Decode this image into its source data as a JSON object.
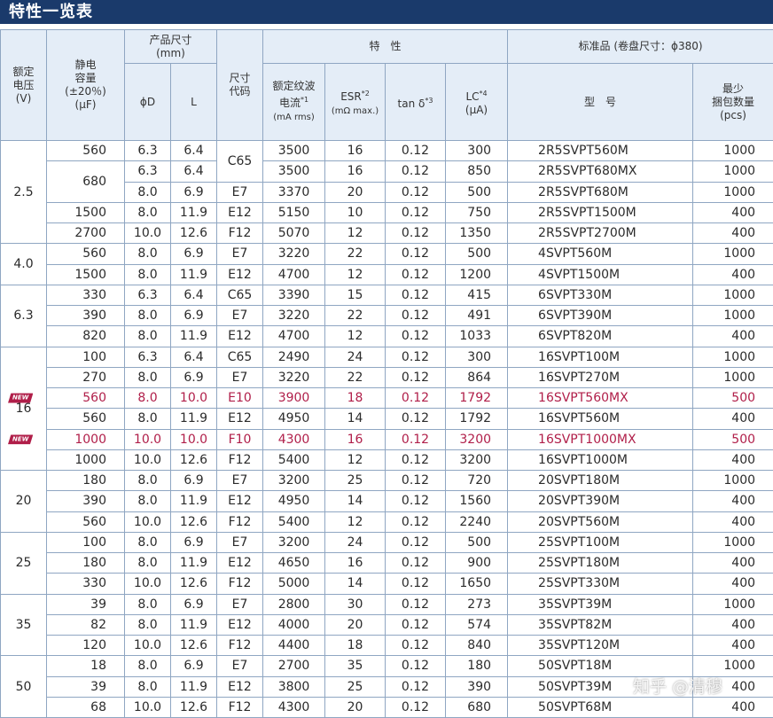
{
  "title": "特性一览表",
  "headers": {
    "voltage": [
      "额定",
      "电压",
      "(V)"
    ],
    "capacitance": [
      "静电",
      "容量",
      "(±20％)",
      "(μF)"
    ],
    "size": [
      "产品尺寸",
      "(mm)"
    ],
    "phi_d": "ϕD",
    "l": "L",
    "size_code": [
      "尺寸",
      "代码"
    ],
    "characteristics": "特　性",
    "ripple": [
      "额定纹波",
      "电流",
      "*1",
      "(mA rms)"
    ],
    "esr": [
      "ESR",
      "*2",
      "(mΩ max.)"
    ],
    "tan": [
      "tan δ",
      "*3"
    ],
    "lc": [
      "LC",
      "*4",
      "(μA)"
    ],
    "standard": "标准品 (卷盘尺寸：ϕ380)",
    "model": "型　号",
    "qty": [
      "最少",
      "捆包数量",
      "(pcs)"
    ]
  },
  "badge_label": "NEW",
  "groups": [
    {
      "voltage": "2.5",
      "rows": [
        {
          "cap": "560",
          "d": "6.3",
          "l": "6.4",
          "code": "C65",
          "ripple": "3500",
          "esr": "16",
          "tan": "0.12",
          "lc": "300",
          "model": "2R5SVPT560M",
          "qty": "1000"
        },
        {
          "cap": "680",
          "d": "6.3",
          "l": "6.4",
          "code": "C65",
          "ripple": "3500",
          "esr": "16",
          "tan": "0.12",
          "lc": "850",
          "model": "2R5SVPT680MX",
          "qty": "1000"
        },
        {
          "cap": "680",
          "d": "8.0",
          "l": "6.9",
          "code": "E7",
          "ripple": "3370",
          "esr": "20",
          "tan": "0.12",
          "lc": "500",
          "model": "2R5SVPT680M",
          "qty": "1000"
        },
        {
          "cap": "1500",
          "d": "8.0",
          "l": "11.9",
          "code": "E12",
          "ripple": "5150",
          "esr": "10",
          "tan": "0.12",
          "lc": "750",
          "model": "2R5SVPT1500M",
          "qty": "400"
        },
        {
          "cap": "2700",
          "d": "10.0",
          "l": "12.6",
          "code": "F12",
          "ripple": "5070",
          "esr": "12",
          "tan": "0.12",
          "lc": "1350",
          "model": "2R5SVPT2700M",
          "qty": "400"
        }
      ]
    },
    {
      "voltage": "4.0",
      "rows": [
        {
          "cap": "560",
          "d": "8.0",
          "l": "6.9",
          "code": "E7",
          "ripple": "3220",
          "esr": "22",
          "tan": "0.12",
          "lc": "500",
          "model": "4SVPT560M",
          "qty": "1000"
        },
        {
          "cap": "1500",
          "d": "8.0",
          "l": "11.9",
          "code": "E12",
          "ripple": "4700",
          "esr": "12",
          "tan": "0.12",
          "lc": "1200",
          "model": "4SVPT1500M",
          "qty": "400"
        }
      ]
    },
    {
      "voltage": "6.3",
      "rows": [
        {
          "cap": "330",
          "d": "6.3",
          "l": "6.4",
          "code": "C65",
          "ripple": "3390",
          "esr": "15",
          "tan": "0.12",
          "lc": "415",
          "model": "6SVPT330M",
          "qty": "1000"
        },
        {
          "cap": "390",
          "d": "8.0",
          "l": "6.9",
          "code": "E7",
          "ripple": "3220",
          "esr": "22",
          "tan": "0.12",
          "lc": "491",
          "model": "6SVPT390M",
          "qty": "1000"
        },
        {
          "cap": "820",
          "d": "8.0",
          "l": "11.9",
          "code": "E12",
          "ripple": "4700",
          "esr": "12",
          "tan": "0.12",
          "lc": "1033",
          "model": "6SVPT820M",
          "qty": "400"
        }
      ]
    },
    {
      "voltage": "16",
      "rows": [
        {
          "cap": "100",
          "d": "6.3",
          "l": "6.4",
          "code": "C65",
          "ripple": "2490",
          "esr": "24",
          "tan": "0.12",
          "lc": "300",
          "model": "16SVPT100M",
          "qty": "1000"
        },
        {
          "cap": "270",
          "d": "8.0",
          "l": "6.9",
          "code": "E7",
          "ripple": "3220",
          "esr": "22",
          "tan": "0.12",
          "lc": "864",
          "model": "16SVPT270M",
          "qty": "1000"
        },
        {
          "cap": "560",
          "d": "8.0",
          "l": "10.0",
          "code": "E10",
          "ripple": "3900",
          "esr": "18",
          "tan": "0.12",
          "lc": "1792",
          "model": "16SVPT560MX",
          "qty": "500",
          "new": true
        },
        {
          "cap": "560",
          "d": "8.0",
          "l": "11.9",
          "code": "E12",
          "ripple": "4950",
          "esr": "14",
          "tan": "0.12",
          "lc": "1792",
          "model": "16SVPT560M",
          "qty": "400"
        },
        {
          "cap": "1000",
          "d": "10.0",
          "l": "10.0",
          "code": "F10",
          "ripple": "4300",
          "esr": "16",
          "tan": "0.12",
          "lc": "3200",
          "model": "16SVPT1000MX",
          "qty": "500",
          "new": true
        },
        {
          "cap": "1000",
          "d": "10.0",
          "l": "12.6",
          "code": "F12",
          "ripple": "5400",
          "esr": "12",
          "tan": "0.12",
          "lc": "3200",
          "model": "16SVPT1000M",
          "qty": "400"
        }
      ]
    },
    {
      "voltage": "20",
      "rows": [
        {
          "cap": "180",
          "d": "8.0",
          "l": "6.9",
          "code": "E7",
          "ripple": "3200",
          "esr": "25",
          "tan": "0.12",
          "lc": "720",
          "model": "20SVPT180M",
          "qty": "1000"
        },
        {
          "cap": "390",
          "d": "8.0",
          "l": "11.9",
          "code": "E12",
          "ripple": "4950",
          "esr": "14",
          "tan": "0.12",
          "lc": "1560",
          "model": "20SVPT390M",
          "qty": "400"
        },
        {
          "cap": "560",
          "d": "10.0",
          "l": "12.6",
          "code": "F12",
          "ripple": "5400",
          "esr": "12",
          "tan": "0.12",
          "lc": "2240",
          "model": "20SVPT560M",
          "qty": "400"
        }
      ]
    },
    {
      "voltage": "25",
      "rows": [
        {
          "cap": "100",
          "d": "8.0",
          "l": "6.9",
          "code": "E7",
          "ripple": "3200",
          "esr": "24",
          "tan": "0.12",
          "lc": "500",
          "model": "25SVPT100M",
          "qty": "1000"
        },
        {
          "cap": "180",
          "d": "8.0",
          "l": "11.9",
          "code": "E12",
          "ripple": "4650",
          "esr": "16",
          "tan": "0.12",
          "lc": "900",
          "model": "25SVPT180M",
          "qty": "400"
        },
        {
          "cap": "330",
          "d": "10.0",
          "l": "12.6",
          "code": "F12",
          "ripple": "5000",
          "esr": "14",
          "tan": "0.12",
          "lc": "1650",
          "model": "25SVPT330M",
          "qty": "400"
        }
      ]
    },
    {
      "voltage": "35",
      "rows": [
        {
          "cap": "39",
          "d": "8.0",
          "l": "6.9",
          "code": "E7",
          "ripple": "2800",
          "esr": "30",
          "tan": "0.12",
          "lc": "273",
          "model": "35SVPT39M",
          "qty": "1000"
        },
        {
          "cap": "82",
          "d": "8.0",
          "l": "11.9",
          "code": "E12",
          "ripple": "4000",
          "esr": "20",
          "tan": "0.12",
          "lc": "574",
          "model": "35SVPT82M",
          "qty": "400"
        },
        {
          "cap": "120",
          "d": "10.0",
          "l": "12.6",
          "code": "F12",
          "ripple": "4400",
          "esr": "18",
          "tan": "0.12",
          "lc": "840",
          "model": "35SVPT120M",
          "qty": "400"
        }
      ]
    },
    {
      "voltage": "50",
      "rows": [
        {
          "cap": "18",
          "d": "8.0",
          "l": "6.9",
          "code": "E7",
          "ripple": "2700",
          "esr": "35",
          "tan": "0.12",
          "lc": "180",
          "model": "50SVPT18M",
          "qty": "1000"
        },
        {
          "cap": "39",
          "d": "8.0",
          "l": "11.9",
          "code": "E12",
          "ripple": "3800",
          "esr": "25",
          "tan": "0.12",
          "lc": "390",
          "model": "50SVPT39M",
          "qty": "400"
        },
        {
          "cap": "68",
          "d": "10.0",
          "l": "12.6",
          "code": "F12",
          "ripple": "4300",
          "esr": "20",
          "tan": "0.12",
          "lc": "680",
          "model": "50SVPT68M",
          "qty": "400"
        }
      ]
    }
  ],
  "watermark": "知乎 @清穆"
}
